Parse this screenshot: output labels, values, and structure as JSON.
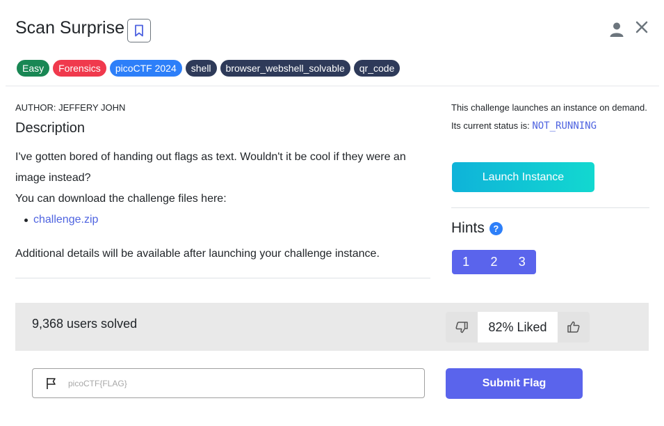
{
  "header": {
    "title": "Scan Surprise",
    "bookmark_icon": "bookmark-icon",
    "user_icon": "user-icon",
    "close_icon": "close-icon"
  },
  "tags": [
    {
      "label": "Easy",
      "color": "#198754"
    },
    {
      "label": "Forensics",
      "color": "#f0394d"
    },
    {
      "label": "picoCTF 2024",
      "color": "#2d7ff9"
    },
    {
      "label": "shell",
      "color": "#2e3a59"
    },
    {
      "label": "browser_webshell_solvable",
      "color": "#2e3a59"
    },
    {
      "label": "qr_code",
      "color": "#2e3a59"
    }
  ],
  "description": {
    "author": "AUTHOR: JEFFERY JOHN",
    "heading": "Description",
    "line1": "I've gotten bored of handing out flags as text. Wouldn't it be cool if they were an image instead?",
    "line2": "You can download the challenge files here:",
    "file_link": "challenge.zip",
    "additional": "Additional details will be available after launching your challenge instance."
  },
  "instance": {
    "info": "This challenge launches an instance on demand.",
    "status_prefix": "Its current status is:",
    "status": "NOT_RUNNING",
    "launch_label": "Launch Instance"
  },
  "hints": {
    "heading": "Hints",
    "help_icon": "?",
    "buttons": [
      "1",
      "2",
      "3"
    ]
  },
  "stats": {
    "solved": "9,368 users solved",
    "liked": "82% Liked"
  },
  "flag": {
    "placeholder": "picoCTF{FLAG}",
    "submit_label": "Submit Flag"
  },
  "colors": {
    "accent": "#5a64ec",
    "launch_gradient_start": "#0fb3d9",
    "launch_gradient_end": "#12d8d0",
    "status_text": "#4e63e0"
  }
}
